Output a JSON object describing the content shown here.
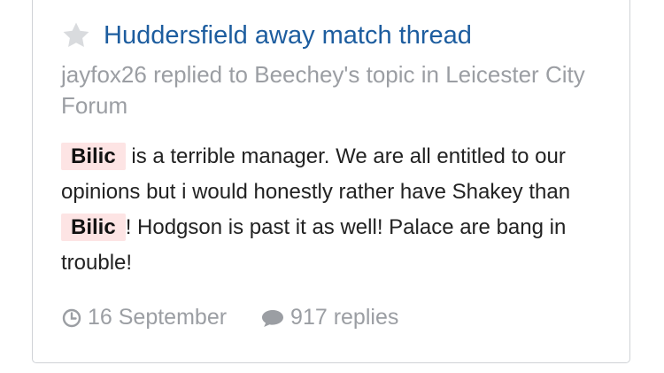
{
  "topic": {
    "title": "Huddersfield away match thread",
    "meta": "jayfox26 replied to Beechey's topic in Leicester City Forum"
  },
  "post": {
    "highlight_term": "Bilic",
    "segment_1": " is a terrible manager. We are all entitled to our opinions but i would honestly rather have Shakey than ",
    "segment_2": "! Hodgson is past it as well! Palace are bang in trouble!"
  },
  "footer": {
    "date": "16 September",
    "replies": "917 replies"
  },
  "colors": {
    "title": "#1d5d9f",
    "meta": "#9b9ea3",
    "highlight_bg": "#fde4e4",
    "star": "#d9dbde"
  },
  "icons": {
    "star": "star-icon",
    "clock": "clock-icon",
    "comment": "comment-icon"
  }
}
